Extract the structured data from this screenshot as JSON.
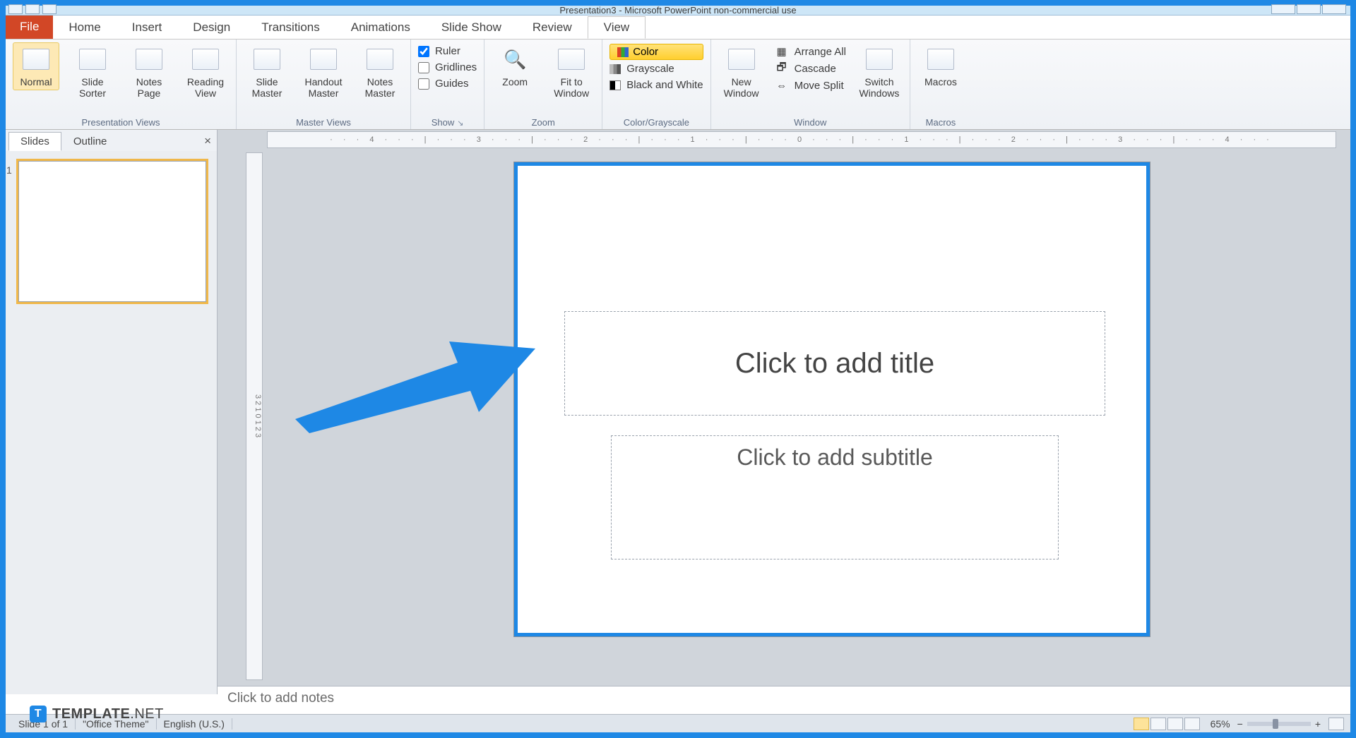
{
  "titlebar": {
    "text": "Presentation3 - Microsoft PowerPoint non-commercial use"
  },
  "tabs": {
    "file": "File",
    "items": [
      "Home",
      "Insert",
      "Design",
      "Transitions",
      "Animations",
      "Slide Show",
      "Review",
      "View"
    ],
    "active": "View"
  },
  "ribbon": {
    "presentation_views": {
      "label": "Presentation Views",
      "normal": "Normal",
      "slide_sorter": "Slide\nSorter",
      "notes_page": "Notes\nPage",
      "reading_view": "Reading\nView"
    },
    "master_views": {
      "label": "Master Views",
      "slide_master": "Slide\nMaster",
      "handout_master": "Handout\nMaster",
      "notes_master": "Notes\nMaster"
    },
    "show": {
      "label": "Show",
      "ruler": "Ruler",
      "gridlines": "Gridlines",
      "guides": "Guides"
    },
    "zoom": {
      "label": "Zoom",
      "zoom": "Zoom",
      "fit": "Fit to\nWindow"
    },
    "color": {
      "label": "Color/Grayscale",
      "color": "Color",
      "grayscale": "Grayscale",
      "bw": "Black and White"
    },
    "window": {
      "label": "Window",
      "new_window": "New\nWindow",
      "arrange_all": "Arrange All",
      "cascade": "Cascade",
      "move_split": "Move Split",
      "switch": "Switch\nWindows"
    },
    "macros": {
      "label": "Macros",
      "macros": "Macros"
    }
  },
  "thumbpane": {
    "tabs": {
      "slides": "Slides",
      "outline": "Outline"
    },
    "close": "×"
  },
  "slide": {
    "title_placeholder": "Click to add title",
    "subtitle_placeholder": "Click to add subtitle"
  },
  "ruler": {
    "h": "· · · 4 · · · | · · · 3 · · · | · · · 2 · · · | · · · 1 · · · | · · · 0 · · · | · · · 1 · · · | · · · 2 · · · | · · · 3 · · · | · · · 4 · · ·",
    "v": "3  2  1  0  1  2  3"
  },
  "notes": {
    "placeholder": "Click to add notes"
  },
  "status": {
    "slide": "Slide 1 of 1",
    "theme": "\"Office Theme\"",
    "lang": "English (U.S.)",
    "zoom": "65%"
  },
  "watermark": {
    "brand": "TEMPLATE",
    "suffix": ".NET"
  }
}
